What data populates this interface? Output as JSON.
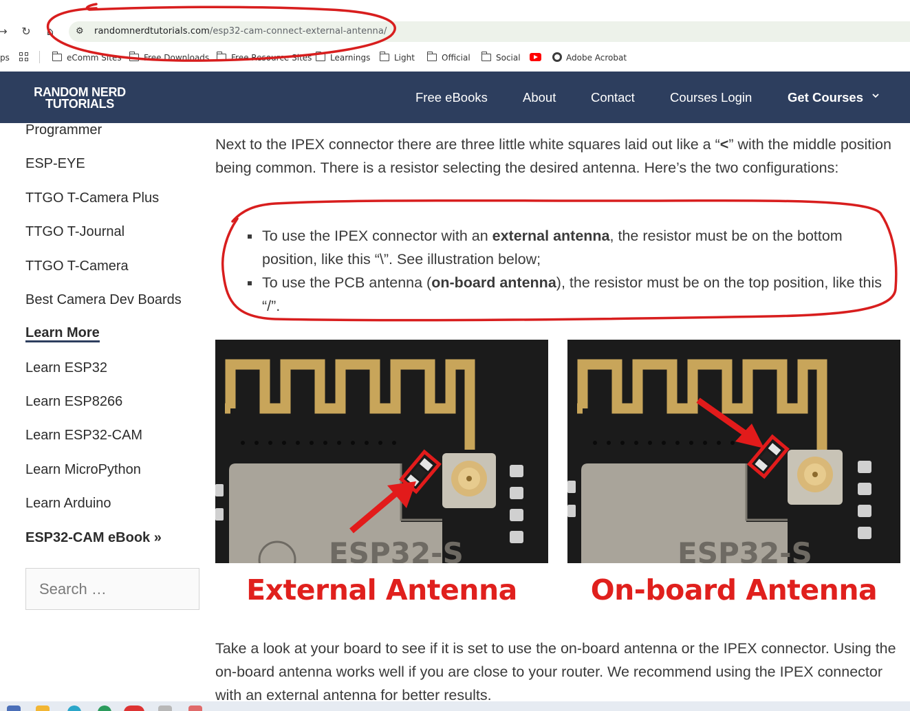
{
  "browser": {
    "url_domain": "randomnerdtutorials.com",
    "url_path": "/esp32-cam-connect-external-antenna/",
    "left_cut_label": "ps",
    "bookmarks": [
      {
        "label": "eComm Sites",
        "icon": "folder-icon"
      },
      {
        "label": "Free Downloads",
        "icon": "folder-icon"
      },
      {
        "label": "Free Resource Sites",
        "icon": "folder-icon"
      },
      {
        "label": "Learnings",
        "icon": "folder-icon"
      },
      {
        "label": "Light",
        "icon": "folder-icon"
      },
      {
        "label": "Official",
        "icon": "folder-icon"
      },
      {
        "label": "Social",
        "icon": "folder-icon"
      },
      {
        "label": "",
        "icon": "youtube-icon"
      },
      {
        "label": "Adobe Acrobat",
        "icon": "globe-icon"
      }
    ]
  },
  "header": {
    "logo_line1": "RANDOM NERD",
    "logo_line2": "TUTORIALS",
    "menu": [
      "Free eBooks",
      "About",
      "Contact",
      "Courses Login",
      "Get Courses"
    ],
    "colors": {
      "bar": "#2d3e5e",
      "text": "#ffffff"
    }
  },
  "sidebar": {
    "items": [
      "Programmer",
      "ESP-EYE",
      "TTGO T-Camera Plus",
      "TTGO T-Journal",
      "TTGO T-Camera",
      "Best Camera Dev Boards"
    ],
    "learn_more_heading": "Learn More",
    "learn_items": [
      "Learn ESP32",
      "Learn ESP8266",
      "Learn ESP32-CAM",
      "Learn MicroPython",
      "Learn Arduino"
    ],
    "ebook_link": "ESP32-CAM eBook »",
    "search_placeholder": "Search …"
  },
  "article": {
    "intro_pre": "Next to the IPEX connector there are three little white squares laid out like a “",
    "intro_symbol": "<",
    "intro_post": "” with the middle position being common. There is a resistor selecting the desired antenna. Here’s the two configurations:",
    "bullet1_pre": "To use the IPEX connector with an ",
    "bullet1_bold": "external antenna",
    "bullet1_post": ", the resistor must be on the bottom position, like this “\\”. See illustration below;",
    "bullet2_pre": "To use the PCB antenna (",
    "bullet2_bold": "on-board antenna",
    "bullet2_post": "), the resistor must be on the top position, like this “/”.",
    "caption_left": "External Antenna",
    "caption_right": "On-board Antenna",
    "photo_chip_label": "ESP32-S",
    "outro": "Take a look at your board to see if it is set to use the on-board antenna or the IPEX connector. Using the on-board antenna works well if you are close to your router. We recommend using the IPEX connector with an external antenna for better results."
  },
  "annotations": {
    "ink_color": "#d81e1e",
    "caption_color": "#e0201d"
  }
}
